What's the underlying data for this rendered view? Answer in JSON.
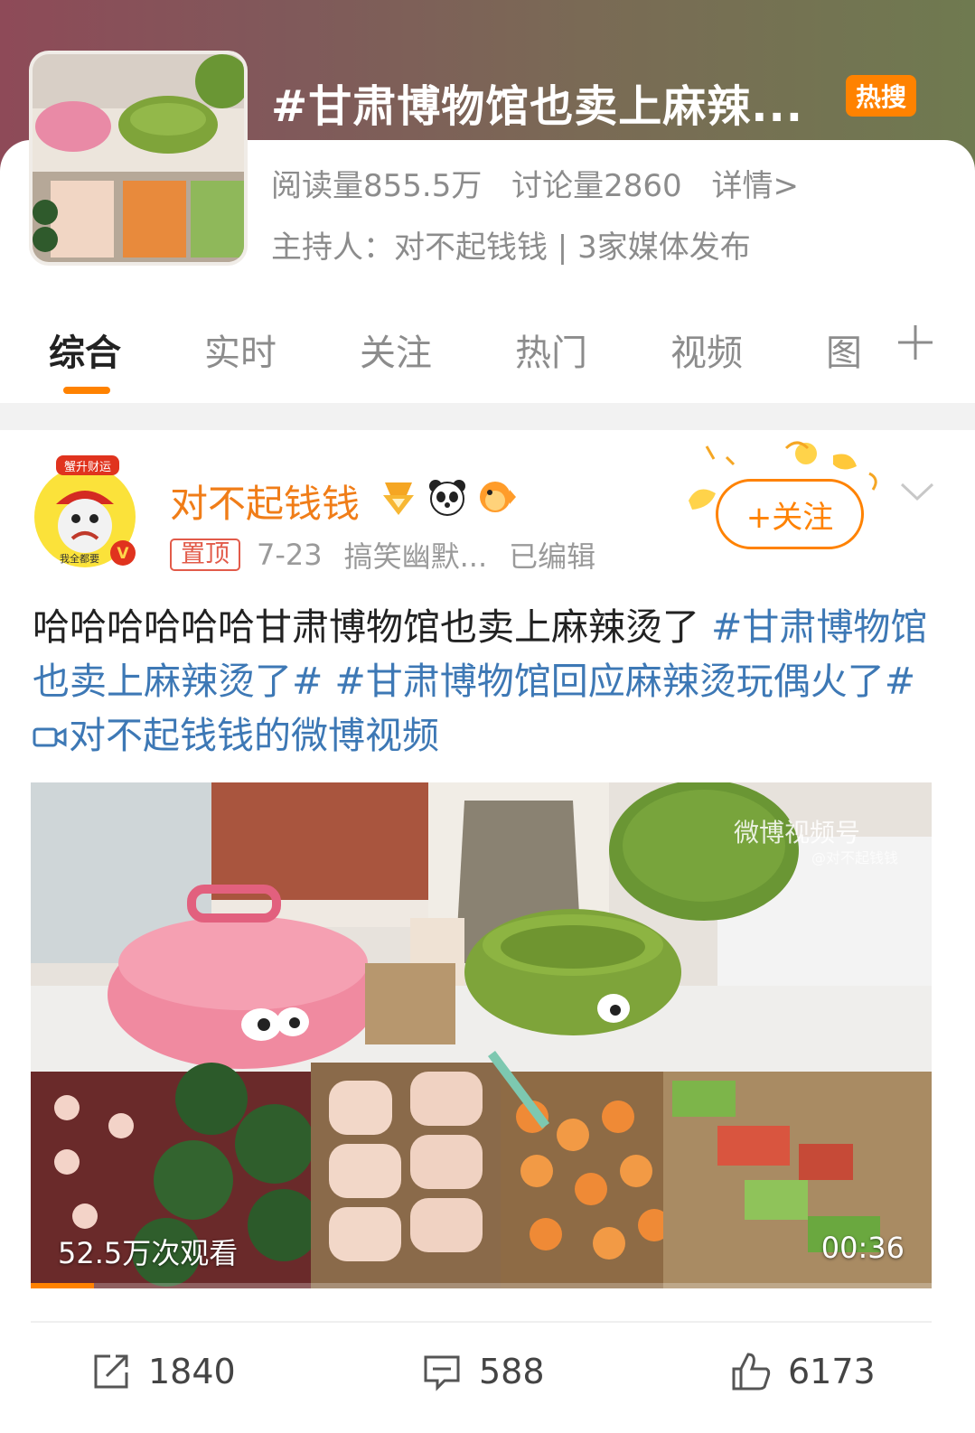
{
  "topic": {
    "title": "#甘肃博物馆也卖上麻辣...",
    "hot_badge": "热搜",
    "reads": "阅读量855.5万",
    "discussions": "讨论量2860",
    "details": "详情>",
    "host_line": "主持人：对不起钱钱 | 3家媒体发布"
  },
  "tabs": [
    {
      "label": "综合",
      "active": true
    },
    {
      "label": "实时"
    },
    {
      "label": "关注"
    },
    {
      "label": "热门"
    },
    {
      "label": "视频"
    },
    {
      "label": "图"
    }
  ],
  "post": {
    "author": "对不起钱钱",
    "pin_label": "置顶",
    "date": "7-23",
    "category": "搞笑幽默...",
    "edited": "已编辑",
    "follow_label": "+关注",
    "text_plain": "哈哈哈哈哈哈甘肃博物馆也卖上麻辣烫了 ",
    "tag1": "#甘肃博物馆也卖上麻辣烫了#",
    "tag2": " #甘肃博物馆回应麻辣烫玩偶火了#",
    "video_link": "对不起钱钱的微博视频",
    "avatar_caption_top": "蟹升财运",
    "avatar_caption_bottom": "我全都要"
  },
  "video": {
    "views": "52.5万次观看",
    "duration": "00:36",
    "watermark": "微博视频号",
    "watermark_sub": "@对不起钱钱",
    "progress": 0.07
  },
  "actions": {
    "share_count": "1840",
    "comment_count": "588",
    "like_count": "6173"
  },
  "colors": {
    "accent": "#ff8200",
    "author": "#f07d18",
    "hashtag": "#3d78b5",
    "pin": "#e25b4a"
  }
}
